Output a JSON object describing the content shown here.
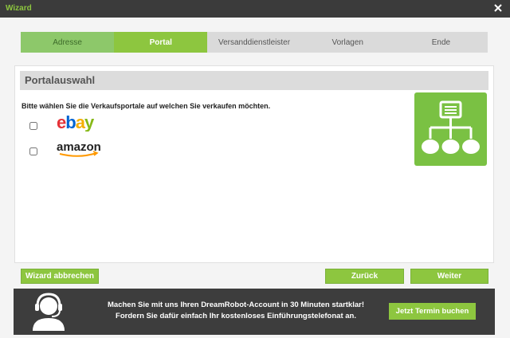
{
  "window": {
    "title": "Wizard",
    "close_icon": "close-icon"
  },
  "steps": [
    {
      "label": "Adresse",
      "state": "done"
    },
    {
      "label": "Portal",
      "state": "active"
    },
    {
      "label": "Versanddienstleister",
      "state": "pending"
    },
    {
      "label": "Vorlagen",
      "state": "pending"
    },
    {
      "label": "Ende",
      "state": "pending"
    }
  ],
  "panel": {
    "title": "Portalauswahl",
    "instruction": "Bitte wählen Sie die Verkaufsportale auf welchen Sie verkaufen möchten.",
    "portals": [
      {
        "name": "ebay",
        "checked": false
      },
      {
        "name": "amazon",
        "checked": false
      }
    ],
    "icon": "network-structure-icon"
  },
  "buttons": {
    "cancel": "Wizard abbrechen",
    "back": "Zurück",
    "next": "Weiter"
  },
  "footer": {
    "line1": "Machen Sie mit uns Ihren DreamRobot-Account in 30 Minuten startklar!",
    "line2": "Fordern Sie dafür einfach Ihr kostenloses Einführungstelefonat an.",
    "cta": "Jetzt Termin buchen",
    "icon": "headset-agent-icon"
  },
  "colors": {
    "accent": "#8dc63f",
    "titlebar": "#3b3b3b",
    "ebay_red": "#e53238",
    "ebay_blue": "#0064d2",
    "ebay_yellow": "#f5af02",
    "ebay_green": "#86b817",
    "amazon_orange": "#ff9900"
  }
}
